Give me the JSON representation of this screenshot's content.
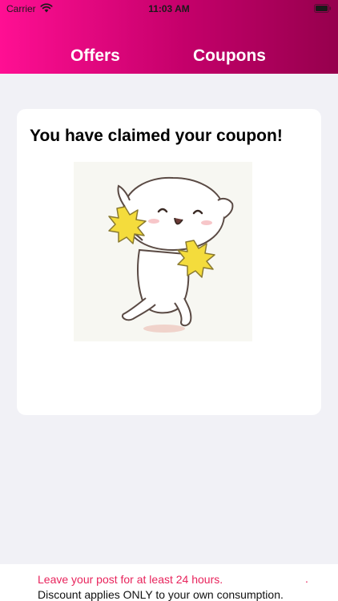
{
  "status_bar": {
    "carrier": "Carrier",
    "time": "11:03 AM"
  },
  "tabs": [
    {
      "label": "Offers"
    },
    {
      "label": "Coupons"
    }
  ],
  "card": {
    "title": "You have claimed your coupon!",
    "image": "cheering-cat-with-pom-poms"
  },
  "footer": {
    "line1": "Leave your post for at least 24 hours.",
    "dot": ".",
    "line2": "Discount applies ONLY to your own consumption."
  },
  "colors": {
    "header_gradient_start": "#ff0f93",
    "header_gradient_end": "#96004d",
    "page_background": "#f1f1f6",
    "warning_text": "#e8245c"
  },
  "icons": {
    "wifi": "wifi-icon",
    "battery": "battery-icon"
  }
}
